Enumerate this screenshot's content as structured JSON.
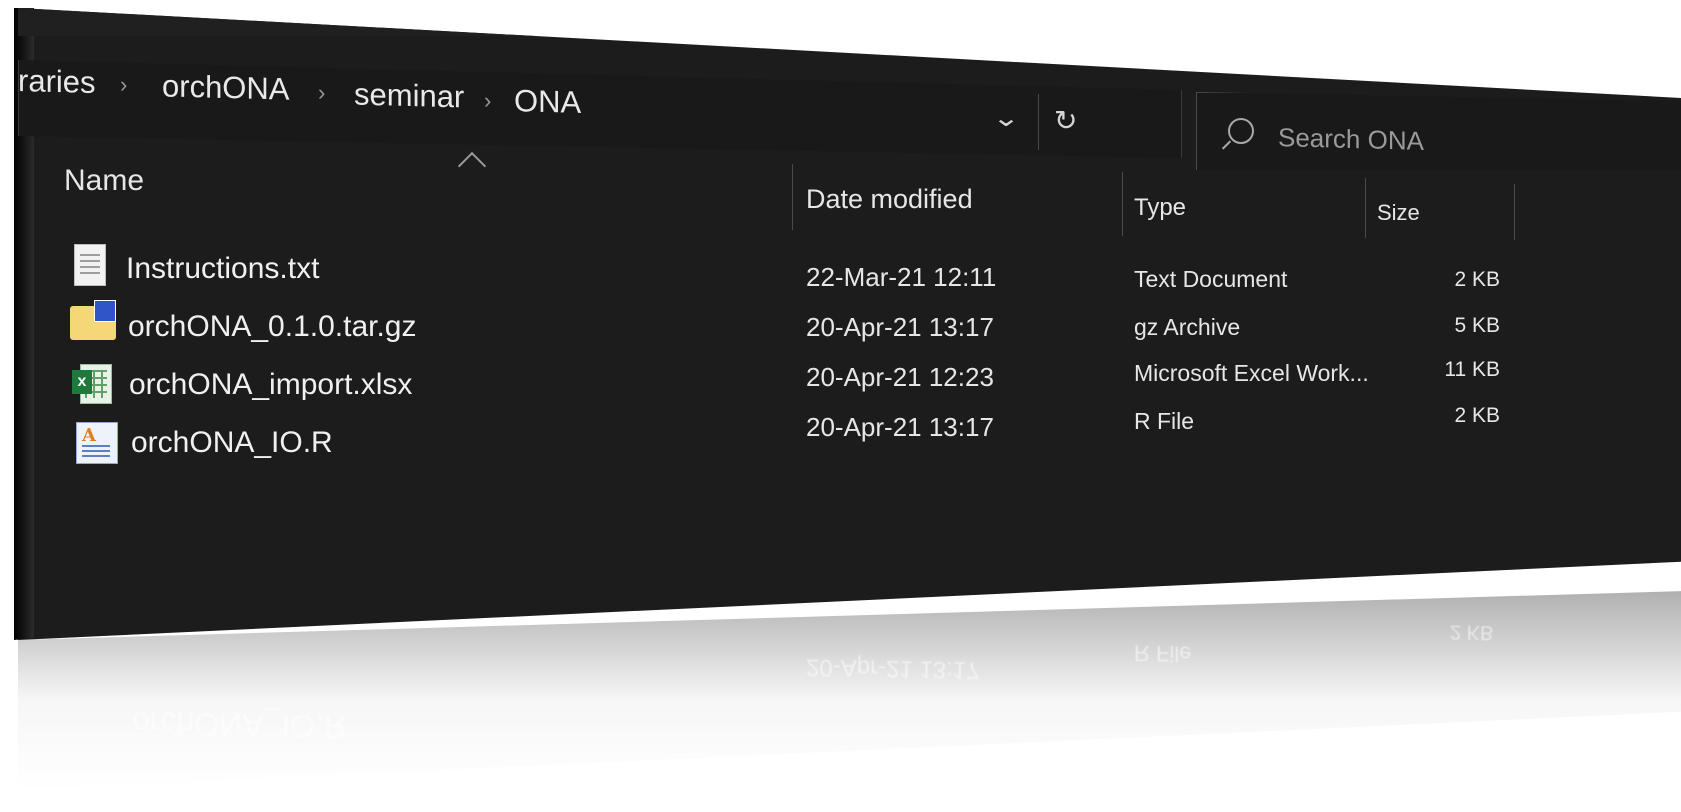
{
  "breadcrumb": {
    "items": [
      "raries",
      "orchONA",
      "seminar",
      "ONA"
    ]
  },
  "address_bar": {
    "dropdown_icon": "chevron-down-icon",
    "refresh_icon": "refresh-icon"
  },
  "search": {
    "placeholder": "Search ONA"
  },
  "columns": {
    "name": "Name",
    "date": "Date modified",
    "type": "Type",
    "size": "Size"
  },
  "files": [
    {
      "name": "Instructions.txt",
      "date": "22-Mar-21 12:11",
      "type": "Text Document",
      "size": "2 KB",
      "icon": "text-file-icon"
    },
    {
      "name": "orchONA_0.1.0.tar.gz",
      "date": "20-Apr-21 13:17",
      "type": "gz Archive",
      "size": "5 KB",
      "icon": "archive-icon"
    },
    {
      "name": "orchONA_import.xlsx",
      "date": "20-Apr-21 12:23",
      "type": "Microsoft Excel Work...",
      "size": "11 KB",
      "icon": "excel-icon"
    },
    {
      "name": "orchONA_IO.R",
      "date": "20-Apr-21 13:17",
      "type": "R File",
      "size": "2 KB",
      "icon": "r-file-icon"
    }
  ],
  "theme": {
    "background": "#1c1c1c",
    "text": "#f0f0f0",
    "divider": "#4a4a4a"
  }
}
